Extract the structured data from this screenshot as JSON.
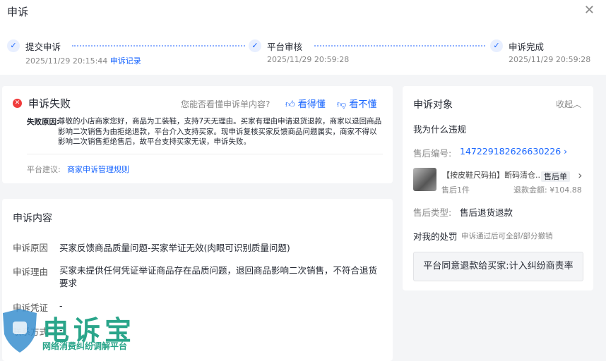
{
  "header": {
    "title": "申诉",
    "close_icon": "close-icon"
  },
  "steps": [
    {
      "label": "提交申诉",
      "time": "2025/11/29 20:15:44",
      "link": "申诉记录"
    },
    {
      "label": "平台审核",
      "time": "2025/11/29 20:59:28"
    },
    {
      "label": "申诉完成",
      "time": "2025/11/29 20:59:28"
    }
  ],
  "result": {
    "status": "申诉失败",
    "question": "您能否看懂申诉单内容?",
    "understand": "看得懂",
    "not_understand": "看不懂",
    "reason_label": "失败原因:",
    "reason": "尊敬的小店商家您好，商品为工装鞋，支持7天无理由。买家有理由申请退货退款，商家以退回商品影响二次销售为由拒绝退款，平台介入支持买家。现申诉复核买家反馈商品问题属实，商家不得以影响二次销售拒绝售后，故平台支持买家无误，申诉失败。",
    "suggest_label": "平台建议:",
    "suggest_link": "商家申诉管理规则"
  },
  "content": {
    "title": "申诉内容",
    "rows": [
      {
        "label": "申诉原因",
        "value": "买家反馈商品质量问题-买家举证无效(肉眼可识别质量问题)"
      },
      {
        "label": "申诉理由",
        "value": "买家未提供任何凭证举证商品存在品质问题，退回商品影响二次销售，不符合退货要求"
      },
      {
        "label": "申诉凭证",
        "value": "-"
      },
      {
        "label": "联系方式",
        "value": "-"
      }
    ]
  },
  "target": {
    "title": "申诉对象",
    "collapse": "收起",
    "why": "我为什么违规",
    "order_label": "售后编号:",
    "order_no": "147229182626630226",
    "product_name": "【按皮鞋尺码拍】断码清仓...",
    "product_tag": "售后单",
    "qty": "售后1件",
    "refund_label": "退款金额:",
    "refund": "¥104.88",
    "type_label": "售后类型:",
    "type": "售后退货退款",
    "penalty_label": "对我的处罚",
    "penalty_note": "申诉通过后可全部/部分撤销",
    "penalty": "平台同意退款给买家:计入纠纷商责率"
  },
  "watermark": {
    "name": "电诉宝",
    "slogan": "网络消费纠纷调解平台"
  }
}
